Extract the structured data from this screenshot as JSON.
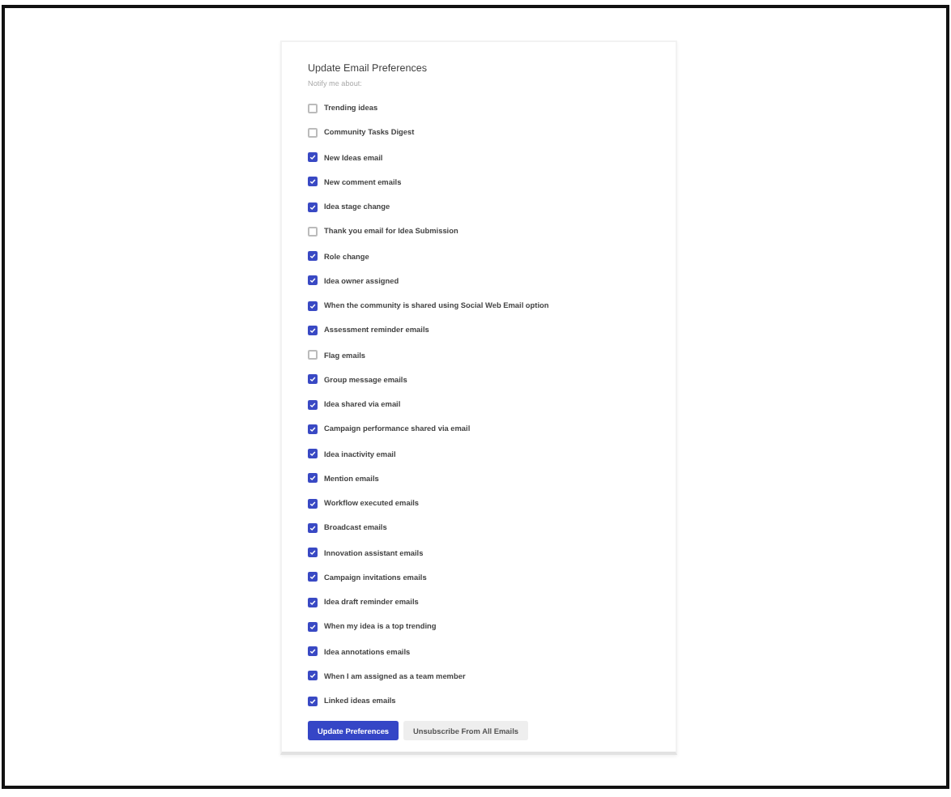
{
  "title": "Update Email Preferences",
  "subtitle": "Notify me about:",
  "options": [
    {
      "label": "Trending ideas",
      "checked": false
    },
    {
      "label": "Community Tasks Digest",
      "checked": false
    },
    {
      "label": "New Ideas email",
      "checked": true
    },
    {
      "label": "New comment emails",
      "checked": true
    },
    {
      "label": "Idea stage change",
      "checked": true
    },
    {
      "label": "Thank you email for Idea Submission",
      "checked": false
    },
    {
      "label": "Role change",
      "checked": true
    },
    {
      "label": "Idea owner assigned",
      "checked": true
    },
    {
      "label": "When the community is shared using Social Web Email option",
      "checked": true
    },
    {
      "label": "Assessment reminder emails",
      "checked": true
    },
    {
      "label": "Flag emails",
      "checked": false
    },
    {
      "label": "Group message emails",
      "checked": true
    },
    {
      "label": "Idea shared via email",
      "checked": true
    },
    {
      "label": "Campaign performance shared via email",
      "checked": true
    },
    {
      "label": "Idea inactivity email",
      "checked": true
    },
    {
      "label": "Mention emails",
      "checked": true
    },
    {
      "label": "Workflow executed emails",
      "checked": true
    },
    {
      "label": "Broadcast emails",
      "checked": true
    },
    {
      "label": "Innovation assistant emails",
      "checked": true
    },
    {
      "label": "Campaign invitations emails",
      "checked": true
    },
    {
      "label": "Idea draft reminder emails",
      "checked": true
    },
    {
      "label": "When my idea is a top trending",
      "checked": true
    },
    {
      "label": "Idea annotations emails",
      "checked": true
    },
    {
      "label": "When I am assigned as a team member",
      "checked": true
    },
    {
      "label": "Linked ideas emails",
      "checked": true
    }
  ],
  "buttons": [
    {
      "label": "Update Preferences",
      "kind": "primary"
    },
    {
      "label": "Unsubscribe From All Emails",
      "kind": "secondary"
    }
  ]
}
